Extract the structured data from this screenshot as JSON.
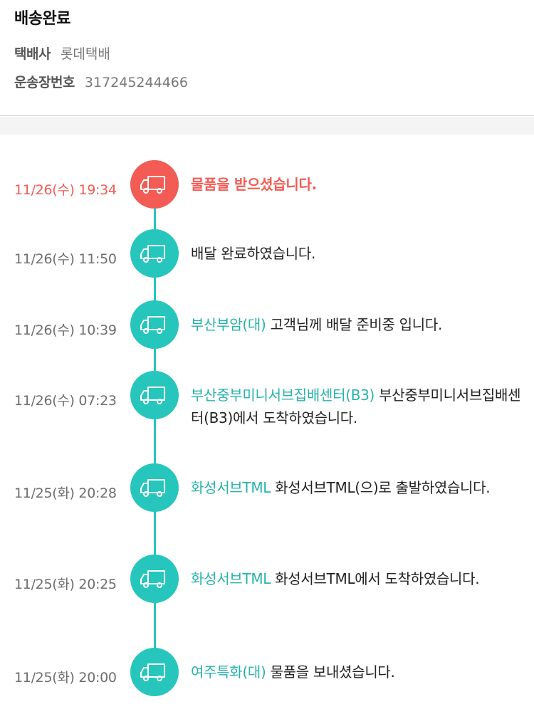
{
  "header": {
    "status": "배송완료",
    "carrier_label": "택배사",
    "carrier_value": "롯데택배",
    "tracking_label": "운송장번호",
    "tracking_value": "317245244466"
  },
  "timeline": [
    {
      "time": "11/26(수) 19:34",
      "location": "",
      "message": "물품을 받으셨습니다.",
      "current": true
    },
    {
      "time": "11/26(수) 11:50",
      "location": "",
      "message": "배달 완료하였습니다."
    },
    {
      "time": "11/26(수) 10:39",
      "location": "부산부암(대)",
      "message": " 고객님께 배달 준비중 입니다."
    },
    {
      "time": "11/26(수) 07:23",
      "location": "부산중부미니서브집배센터(B3)",
      "message": " 부산중부미니서브집배센터(B3)에서 도착하였습니다."
    },
    {
      "time": "11/25(화) 20:28",
      "location": "화성서브TML",
      "message": " 화성서브TML(으)로 출발하였습니다."
    },
    {
      "time": "11/25(화) 20:25",
      "location": "화성서브TML",
      "message": " 화성서브TML에서 도착하였습니다."
    },
    {
      "time": "11/25(화) 20:00",
      "location": "여주특화(대)",
      "message": " 물품을 보내셨습니다."
    }
  ],
  "colors": {
    "accent": "#26c6bd",
    "current": "#f25c54",
    "location_text": "#26b3aa"
  },
  "icons": {
    "event_icon": "delivery-truck-icon"
  }
}
